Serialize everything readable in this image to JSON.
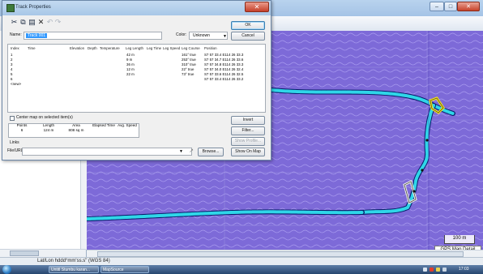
{
  "dialog": {
    "title": "Track Properties",
    "toolbar_icons": [
      "cut-icon",
      "copy-icon",
      "paste-icon",
      "delete-icon",
      "undo-icon",
      "redo-icon"
    ],
    "name_label": "Name:",
    "name_value": "Track 001",
    "color_label": "Color:",
    "color_value": "Unknown",
    "ok_label": "OK",
    "cancel_label": "Cancel",
    "columns": [
      "Index",
      "Time",
      "Elevation",
      "Depth",
      "Temperature",
      "Leg Length",
      "Leg Time",
      "Leg Speed",
      "Leg Course",
      "Position"
    ],
    "rows": [
      {
        "index": "1",
        "leg_length": "42 m",
        "leg_course": "161° true",
        "position": "S7 57 33.4 E114 26 33.3"
      },
      {
        "index": "2",
        "leg_length": "9 m",
        "leg_course": "253° true",
        "position": "S7 57 34.7 E114 26 33.6"
      },
      {
        "index": "3",
        "leg_length": "36 m",
        "leg_course": "310° true",
        "position": "S7 57 34.8 E114 26 33.3"
      },
      {
        "index": "4",
        "leg_length": "12 m",
        "leg_course": "22° true",
        "position": "S7 57 34.0 E114 26 32.4"
      },
      {
        "index": "5",
        "leg_length": "22 m",
        "leg_course": "73° true",
        "position": "S7 57 33.6 E114 26 32.5"
      },
      {
        "index": "6",
        "leg_length": "",
        "leg_course": "",
        "position": "S7 57 33.4 E114 26 33.2"
      }
    ],
    "new_row_label": "<new>",
    "center_map_label": "Center map on selected item(s)",
    "invert_label": "Invert",
    "filter_label": "Filter...",
    "show_profile_label": "Show Profile...",
    "show_on_map_label": "Show On Map",
    "summary_headers": [
      "Points",
      "Length",
      "Area",
      "Elapsed Time",
      "Avg. Speed"
    ],
    "summary_values": [
      "6",
      "124 m",
      "808 sq m",
      "",
      ""
    ],
    "links_label": "Links",
    "file_url_label": "File/URL:",
    "browse_label": "Browse...",
    "file_url_value": ""
  },
  "map": {
    "scale_label": "100 m",
    "map_detail_label": "GPS Map Detail",
    "background_color": "#7d6ad8",
    "track_color": "#2fd6e8",
    "track_outline": "#0a1a6a"
  },
  "status": {
    "text": "Lat/Lon hddd°mm'ss.s\" (WGS 84)"
  },
  "taskbar": {
    "buttons": [
      "Untitl Stumbu karan...",
      "MapSource"
    ],
    "clock": "17:03"
  }
}
